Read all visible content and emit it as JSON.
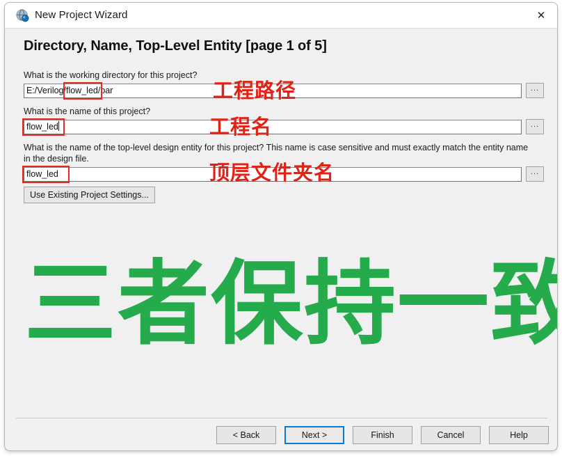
{
  "window": {
    "title": "New Project Wizard",
    "icon": "quartus-globe-icon",
    "close_label": "✕"
  },
  "page": {
    "heading": "Directory, Name, Top-Level Entity [page 1 of 5]"
  },
  "form": {
    "question_directory": "What is the working directory for this project?",
    "question_project_name": "What is the name of this project?",
    "question_top_entity": "What is the name of the top-level design entity for this project? This name is case sensitive and must exactly match the entity name in the design file.",
    "directory_value": "E:/Verilog/flow_led/par",
    "directory_value_prefix": "E:/Verilog/",
    "directory_value_highlight": "flow_led",
    "directory_value_suffix": "/par",
    "project_name_value": "flow_led",
    "top_entity_value": "flow_led",
    "browse_label": "...",
    "use_existing_label": "Use Existing Project Settings..."
  },
  "annotations": {
    "red_1": "工程路径",
    "red_2": "工程名",
    "red_3": "顶层文件夹名",
    "green_big": "三者保持一致",
    "red_color": "#e22217",
    "green_color": "#26ab4c",
    "box_color": "#e8291f"
  },
  "footer": {
    "back": "< Back",
    "next": "Next >",
    "finish": "Finish",
    "cancel": "Cancel",
    "help": "Help",
    "default_button": "Next >",
    "accent_color": "#0a7bd4"
  }
}
